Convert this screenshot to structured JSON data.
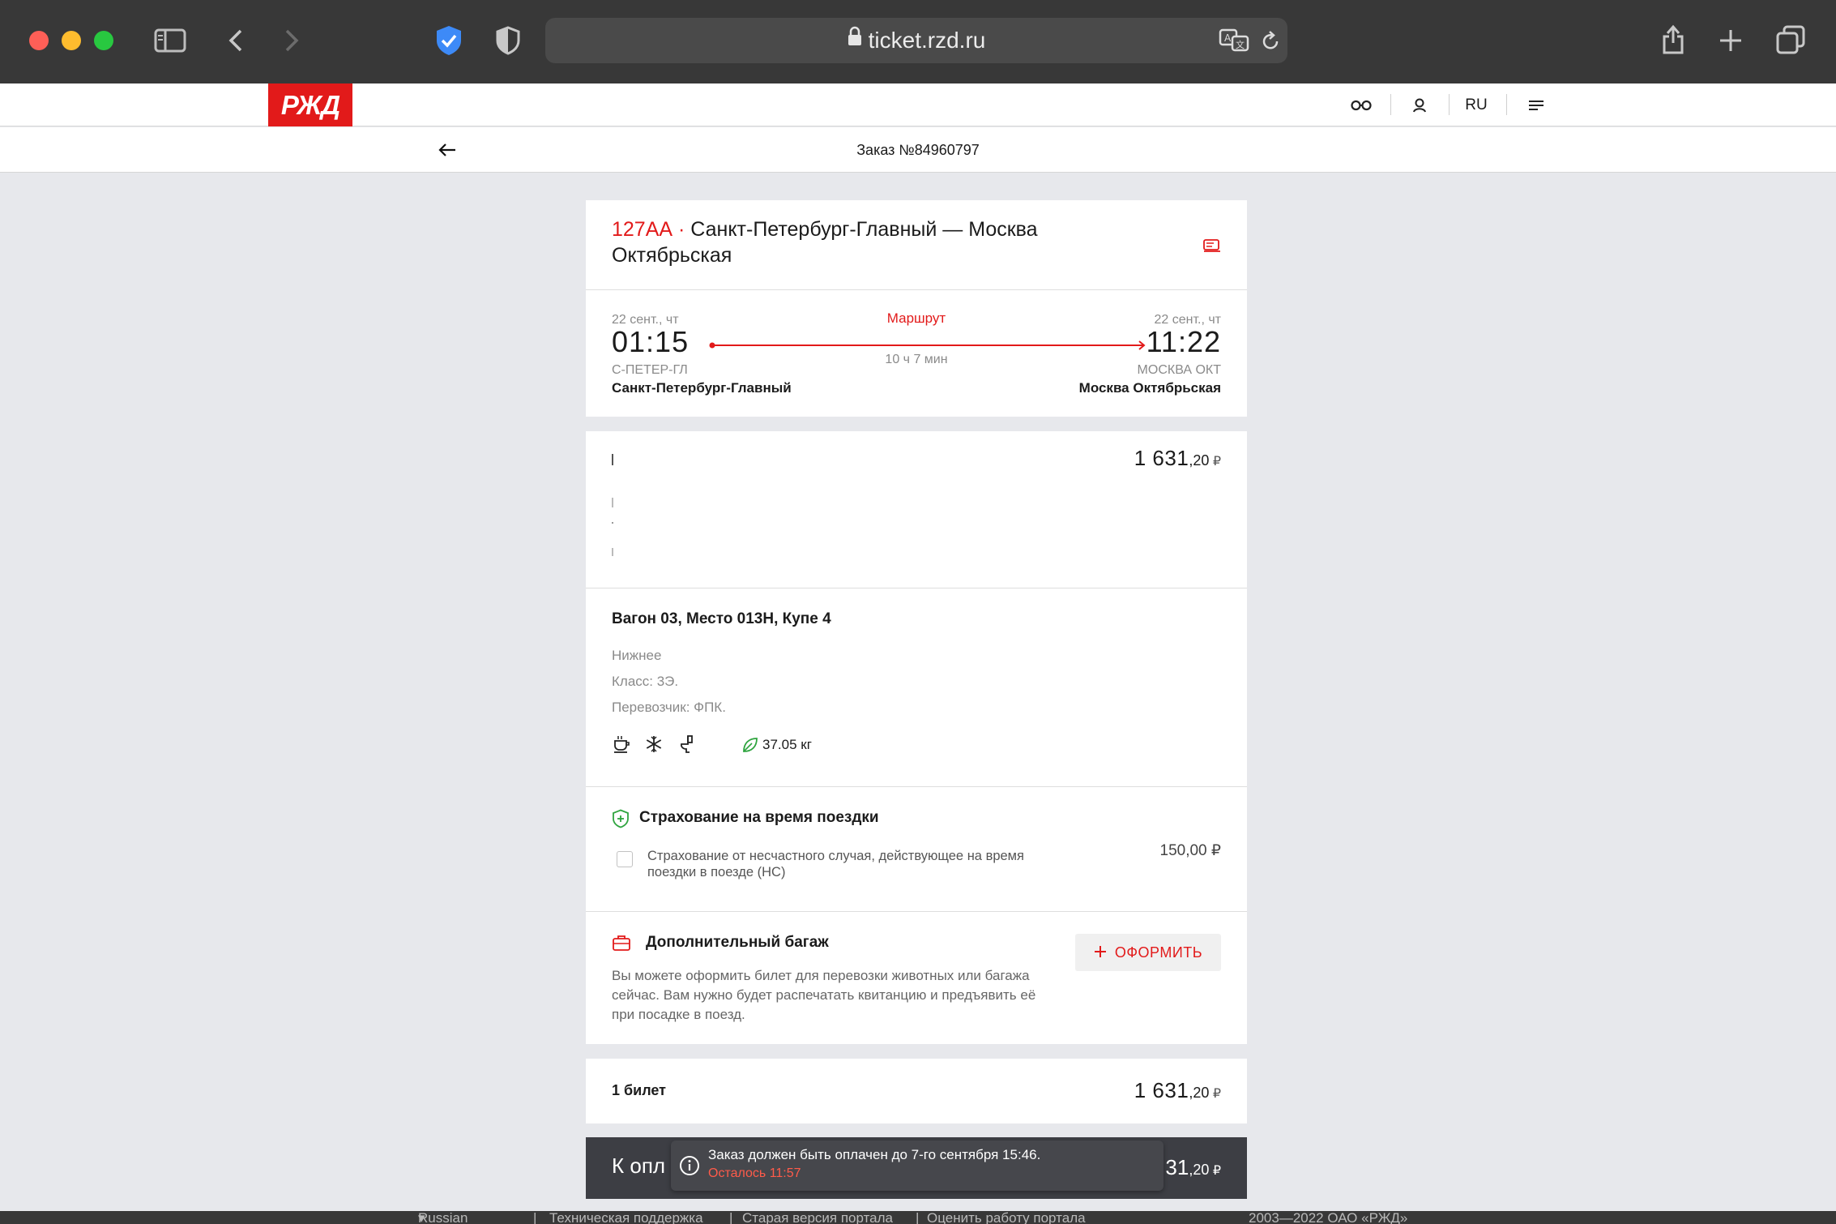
{
  "browser": {
    "url": "ticket.rzd.ru"
  },
  "header": {
    "logo_text": "РЖД",
    "language": "RU"
  },
  "order": {
    "title": "Заказ №84960797"
  },
  "train": {
    "number": "127АА",
    "separator": " · ",
    "route_name": "Санкт-Петербург-Главный — Москва Октябрьская"
  },
  "schedule": {
    "departure_date": "22 сент., чт",
    "departure_time": "01:15",
    "departure_code": "С-ПЕТЕР-ГЛ",
    "departure_station": "Санкт-Петербург-Главный",
    "route_link": "Маршрут",
    "duration": "10 ч 7 мин",
    "arrival_date": "22 сент., чт",
    "arrival_time": "11:22",
    "arrival_code": "МОСКВА ОКТ",
    "arrival_station": "Москва Октябрьская"
  },
  "passenger": {
    "price_main": "1 631",
    "price_cents": ",20",
    "currency": "₽"
  },
  "seat": {
    "title": "Вагон 03, Место 013Н, Купе 4",
    "berth": "Нижнее",
    "class": "Класс: 3Э.",
    "carrier": "Перевозчик: ФПК.",
    "co2": "37.05 кг"
  },
  "insurance": {
    "title": "Страхование на время поездки",
    "option_label": "Страхование от несчастного случая, действующее на время поездки в поезде (НС)",
    "option_price": "150,00 ₽",
    "checked": false
  },
  "baggage": {
    "title": "Дополнительный багаж",
    "button": "ОФОРМИТЬ",
    "description": "Вы можете оформить билет для перевозки животных или багажа сейчас. Вам нужно будет распечатать квитанцию и предъявить её при посадке в поезд."
  },
  "summary": {
    "tickets_label": "1 билет",
    "price_main": "1 631",
    "price_cents": ",20",
    "currency": "₽"
  },
  "payment": {
    "label_visible": "К опл",
    "price_main_visible": "31",
    "price_cents": ",20",
    "currency": "₽"
  },
  "toast": {
    "message": "Заказ должен быть оплачен до 7-го сентября 15:46.",
    "remaining": "Осталось 11:57"
  },
  "footer": {
    "language": "Russian (Ru)",
    "support": "Техническая поддержка",
    "old_version": "Старая версия портала",
    "rate": "Оценить работу портала",
    "copyright": "2003—2022 ОАО «РЖД»"
  },
  "colors": {
    "brand_red": "#e21a1a",
    "accent_green": "#2fa43f",
    "chrome_dark": "#383838"
  }
}
